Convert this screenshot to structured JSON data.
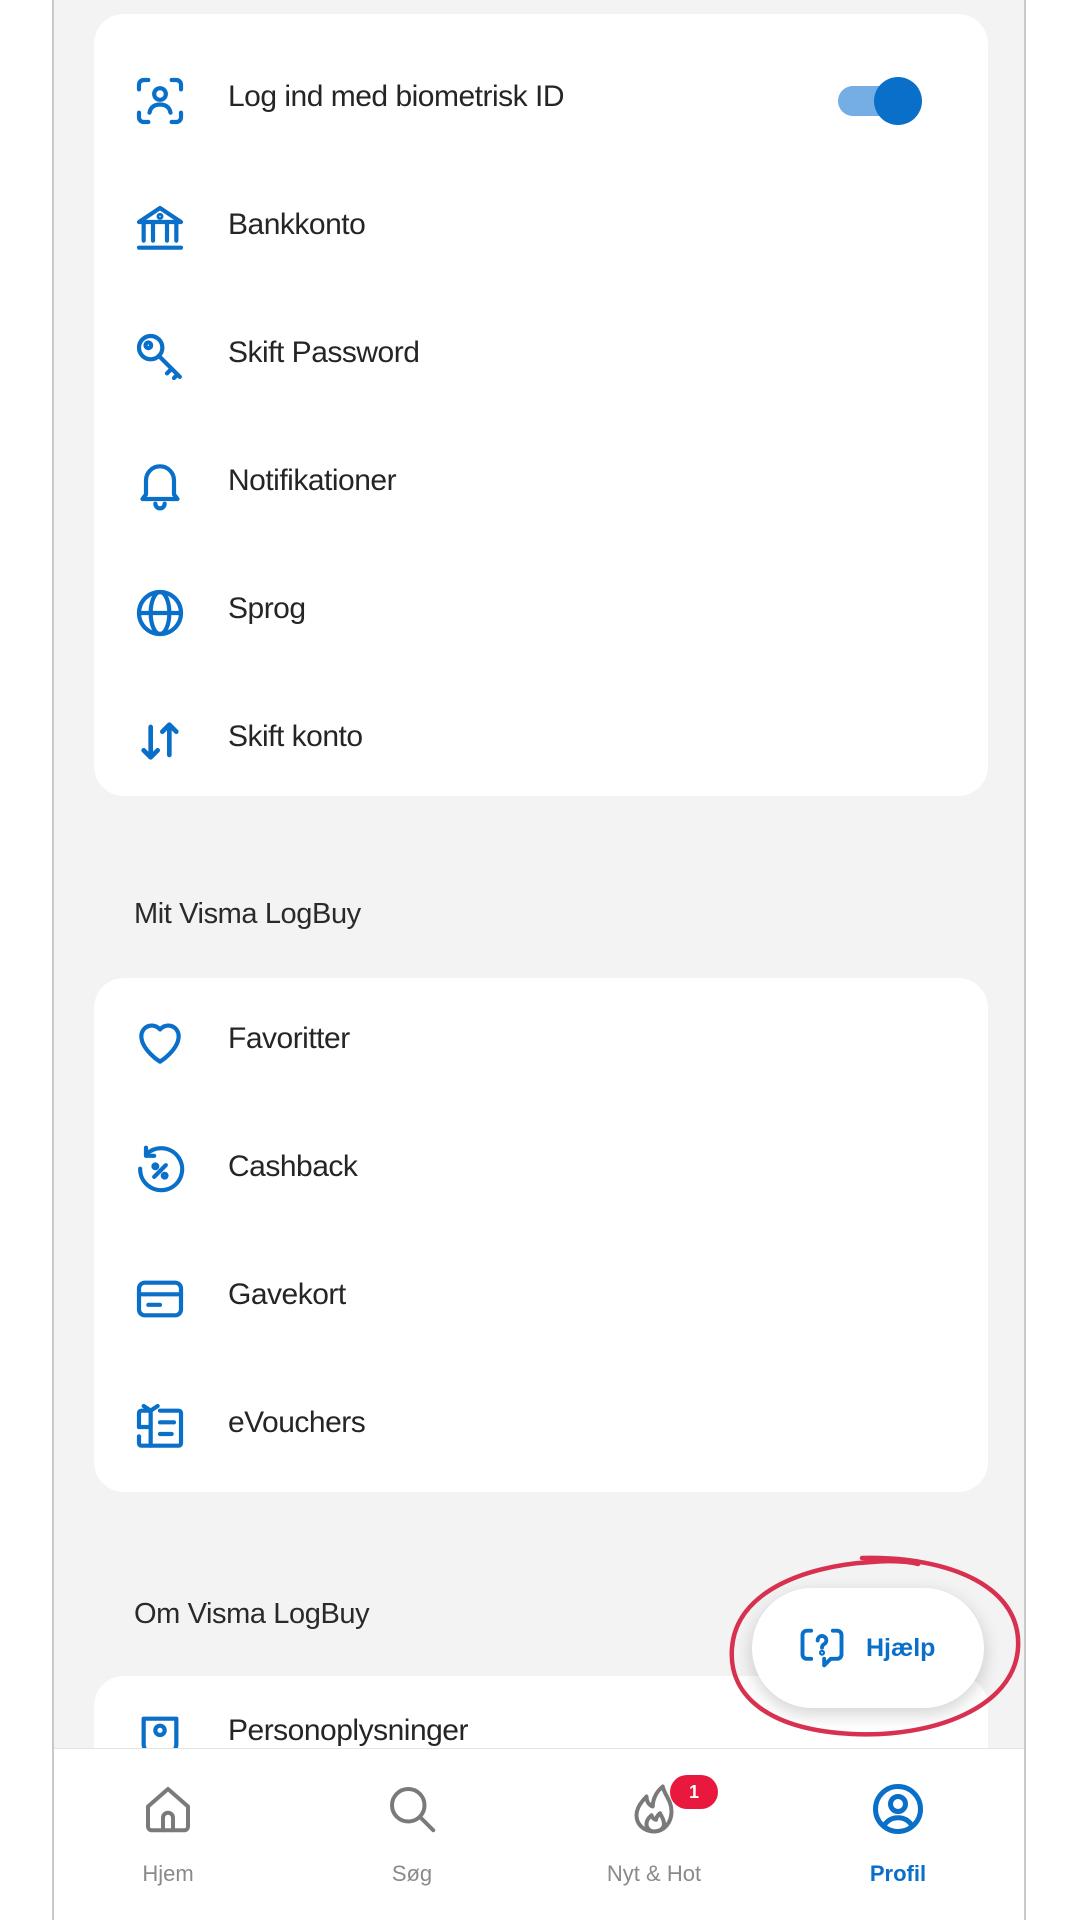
{
  "settings": {
    "biometric": {
      "label": "Log ind med biometrisk ID",
      "icon": "face-id-icon",
      "enabled": true
    },
    "items": [
      {
        "label": "Bankkonto",
        "icon": "bank-icon"
      },
      {
        "label": "Skift Password",
        "icon": "key-icon"
      },
      {
        "label": "Notifikationer",
        "icon": "bell-icon"
      },
      {
        "label": "Sprog",
        "icon": "globe-icon"
      },
      {
        "label": "Skift konto",
        "icon": "swap-arrows-icon"
      }
    ]
  },
  "mit_section": {
    "title": "Mit Visma LogBuy",
    "items": [
      {
        "label": "Favoritter",
        "icon": "heart-icon"
      },
      {
        "label": "Cashback",
        "icon": "cashback-icon"
      },
      {
        "label": "Gavekort",
        "icon": "gift-card-icon"
      },
      {
        "label": "eVouchers",
        "icon": "voucher-icon"
      }
    ]
  },
  "om_section": {
    "title": "Om Visma LogBuy",
    "items": [
      {
        "label": "Personoplysninger",
        "icon": "privacy-icon"
      }
    ]
  },
  "help_button": {
    "label": "Hjælp",
    "icon": "help-chat-icon"
  },
  "tabbar": {
    "tabs": [
      {
        "label": "Hjem",
        "icon": "home-icon",
        "active": false
      },
      {
        "label": "Søg",
        "icon": "search-icon",
        "active": false
      },
      {
        "label": "Nyt & Hot",
        "icon": "flame-icon",
        "active": false,
        "badge": "1"
      },
      {
        "label": "Profil",
        "icon": "profile-icon",
        "active": true
      }
    ]
  },
  "colors": {
    "accent": "#0a6fc9",
    "badge": "#e8183e",
    "annotation": "#d8314f",
    "background": "#f3f3f3"
  }
}
